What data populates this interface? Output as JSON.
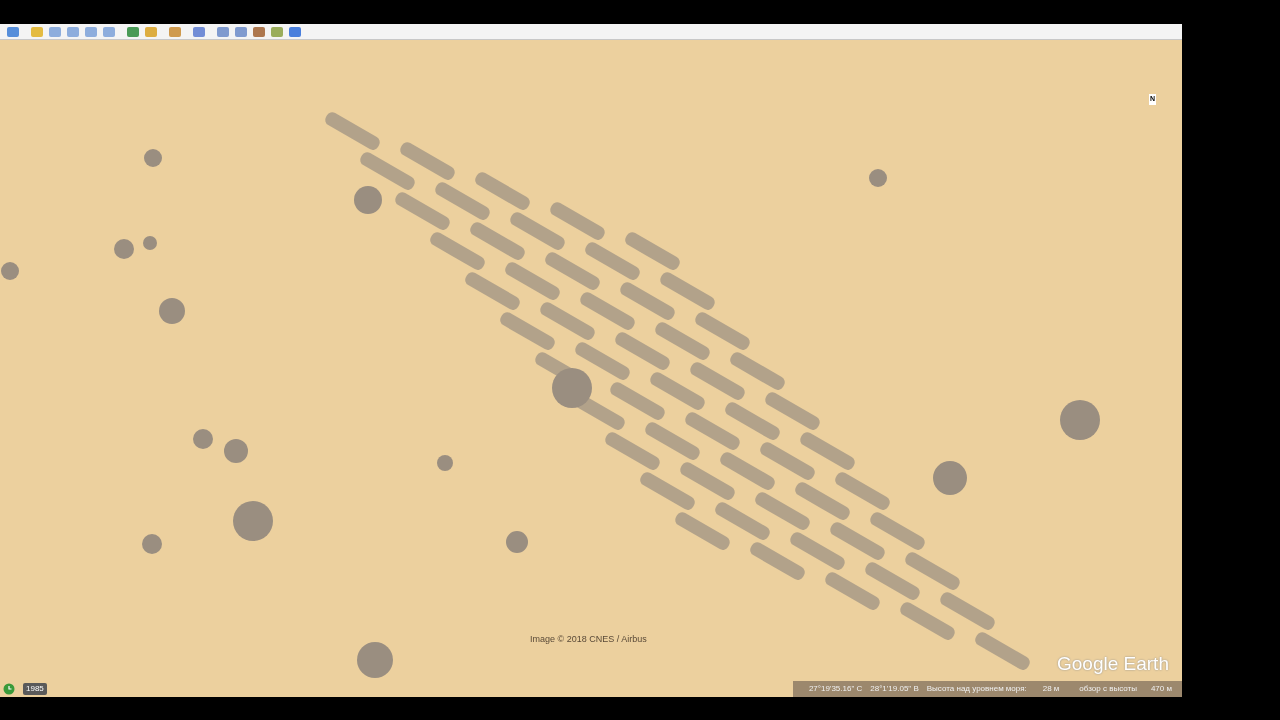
{
  "map": {
    "attribution": "Image © 2018 CNES / Airbus",
    "logo": "Google Earth",
    "compass_label": "N"
  },
  "status_bar": {
    "year": "1985",
    "latitude": "27°19'35.16\" С",
    "longitude": "28°1'19.05\" В",
    "elevation_label": "Высота над уровнем моря:",
    "elevation": "28 м",
    "eye_alt_label": "обзор с высоты",
    "eye_alt": "470 м"
  }
}
